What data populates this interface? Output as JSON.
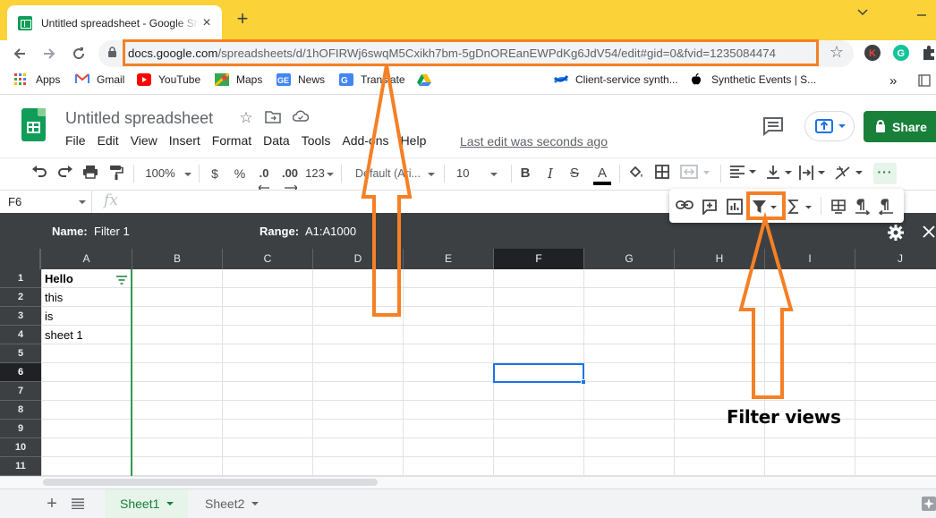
{
  "browser": {
    "tab_title": "Untitled spreadsheet - Google Sheets",
    "tab_close": "×",
    "new_tab": "+",
    "url_host": "docs.google.com",
    "url_path": "/spreadsheets/d/1hOFIRWj6swqM5Cxikh7bm-5gDnOREanEWPdKg6JdV54/edit#gid=0&fvid=1235084474",
    "bookmarks": [
      {
        "label": "Apps",
        "icon": "apps-grid-icon",
        "color": "#ea4335"
      },
      {
        "label": "Gmail",
        "icon": "gmail-icon",
        "color": "#ea4335"
      },
      {
        "label": "YouTube",
        "icon": "youtube-icon",
        "color": "#ff0000"
      },
      {
        "label": "Maps",
        "icon": "maps-icon",
        "color": "#34a853"
      },
      {
        "label": "News",
        "icon": "news-icon",
        "color": "#4285f4"
      },
      {
        "label": "Translate",
        "icon": "translate-icon",
        "color": "#4285f4"
      },
      {
        "label": "",
        "icon": "drive-icon",
        "color": "#fbbc04"
      },
      {
        "label": "Client-service synth...",
        "icon": "confluence-icon",
        "color": "#2684ff"
      },
      {
        "label": "Synthetic Events | S...",
        "icon": "apple-icon",
        "color": "#000000"
      }
    ],
    "bookmarks_more": "»"
  },
  "sheets": {
    "doc_title": "Untitled spreadsheet",
    "menu": [
      "File",
      "Edit",
      "View",
      "Insert",
      "Format",
      "Data",
      "Tools",
      "Add-ons",
      "Help"
    ],
    "last_edit": "Last edit was seconds ago",
    "share_label": "Share",
    "toolbar": {
      "zoom": "100%",
      "currency": "$",
      "percent": "%",
      "dec_decrease": ".0",
      "dec_increase": ".00",
      "number_format": "123",
      "font": "Default (Ari...",
      "font_size": "10",
      "bold": "B",
      "strike": "S",
      "text_color": "A",
      "more": "···"
    },
    "name_box": "F6",
    "fx": "fx",
    "filter_view": {
      "name_label": "Name:",
      "name_value": "Filter 1",
      "range_label": "Range:",
      "range_value": "A1:A1000"
    },
    "columns": [
      "A",
      "B",
      "C",
      "D",
      "E",
      "F",
      "G",
      "H",
      "I",
      "J"
    ],
    "selected_column": "F",
    "rows": [
      "1",
      "2",
      "3",
      "4",
      "5",
      "6",
      "7",
      "8",
      "9",
      "10",
      "11"
    ],
    "selected_row": "6",
    "cells": [
      {
        "ref": "A1",
        "value": "Hello"
      },
      {
        "ref": "A2",
        "value": "this"
      },
      {
        "ref": "A3",
        "value": "is"
      },
      {
        "ref": "A4",
        "value": "sheet 1"
      }
    ],
    "sheet_tabs": [
      {
        "label": "Sheet1",
        "active": true
      },
      {
        "label": "Sheet2",
        "active": false
      }
    ]
  },
  "annotation": {
    "label": "Filter views",
    "color": "#f58025"
  }
}
